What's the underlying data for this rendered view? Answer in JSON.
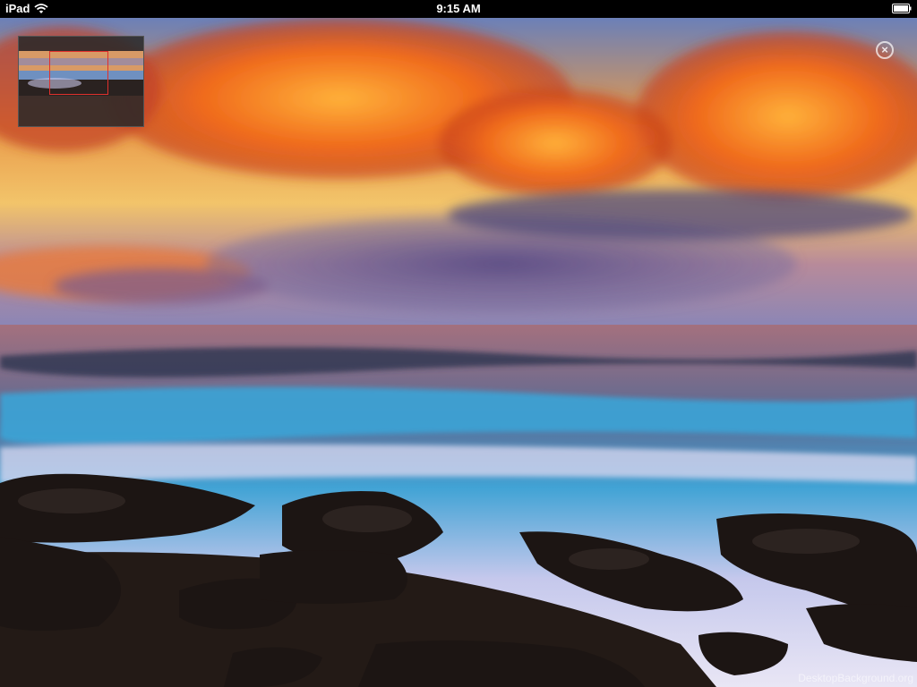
{
  "status_bar": {
    "device": "iPad",
    "time": "9:15 AM"
  },
  "viewer": {
    "close_symbol": "×",
    "watermark": "DesktopBackground.org"
  },
  "icons": {
    "wifi": "wifi-icon",
    "battery": "battery-icon",
    "close": "close-icon"
  },
  "colors": {
    "viewport_frame": "#e0302c"
  }
}
